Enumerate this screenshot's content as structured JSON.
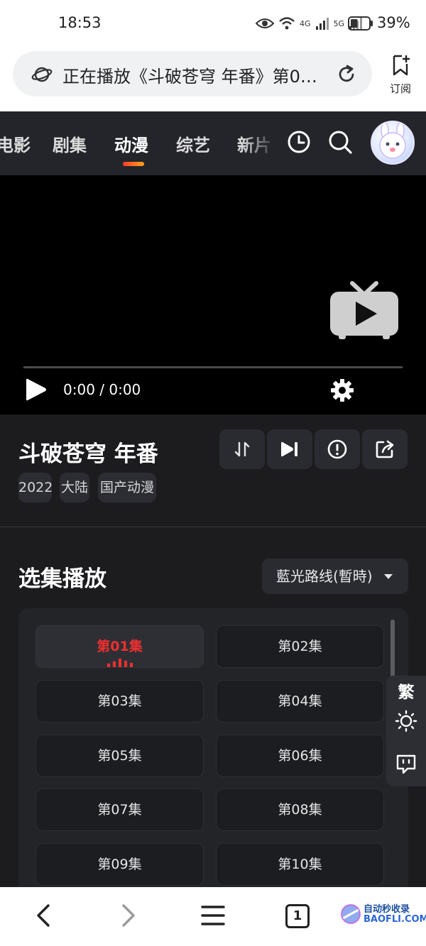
{
  "status_bar": {
    "time": "18:53",
    "net_4g": "4G",
    "net_5g": "5G",
    "battery": "39%",
    "battery_level": 0.39
  },
  "url_bar": {
    "text": "正在播放《斗破苍穹 年番》第01集",
    "subscribe_label": "订阅"
  },
  "nav": {
    "items": [
      "电影",
      "剧集",
      "动漫",
      "综艺",
      "新片"
    ],
    "active": "动漫"
  },
  "player": {
    "time": "0:00 / 0:00",
    "progress": 0
  },
  "show": {
    "title": "斗破苍穹 年番",
    "tags": [
      "2022",
      "大陆",
      "国产动漫"
    ]
  },
  "episodes": {
    "heading": "选集播放",
    "route": "藍光路线(暫時)",
    "items": [
      "第01集",
      "第02集",
      "第03集",
      "第04集",
      "第05集",
      "第06集",
      "第07集",
      "第08集",
      "第09集",
      "第10集"
    ],
    "active_index": 0
  },
  "side_tools": {
    "traditional_label": "繁"
  },
  "bottom_bar": {
    "tab_count": "1"
  },
  "watermark": {
    "line1": "自动秒收录",
    "line2": "BAOFLI.COM"
  },
  "colors": {
    "accent": "#ef2f2f",
    "underline_start": "#ff3a2a",
    "underline_end": "#ffa41c"
  }
}
